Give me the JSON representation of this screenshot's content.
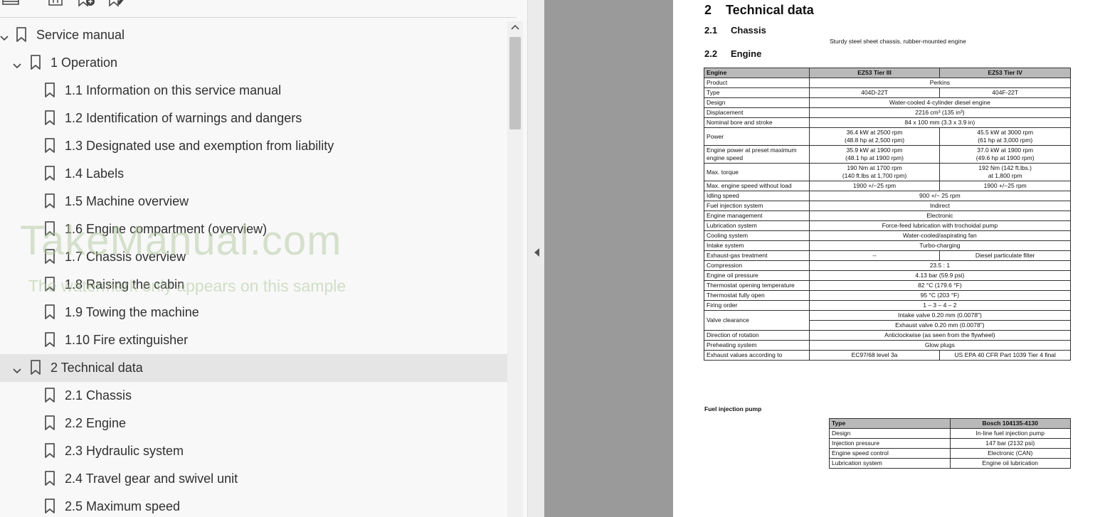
{
  "bookmarks": [
    {
      "label": "Service manual",
      "level": 0,
      "expanded": true,
      "selected": false
    },
    {
      "label": "1 Operation",
      "level": 1,
      "expanded": true,
      "selected": false
    },
    {
      "label": "1.1 Information on this service manual",
      "level": 2
    },
    {
      "label": "1.2 Identification of warnings and dangers",
      "level": 2
    },
    {
      "label": "1.3 Designated use and exemption from liability",
      "level": 2
    },
    {
      "label": "1.4 Labels",
      "level": 2
    },
    {
      "label": "1.5 Machine overview",
      "level": 2
    },
    {
      "label": "1.6 Engine compartment (overview)",
      "level": 2
    },
    {
      "label": "1.7 Chassis overview",
      "level": 2
    },
    {
      "label": "1.8 Raising the cabin",
      "level": 2
    },
    {
      "label": "1.9 Towing the machine",
      "level": 2
    },
    {
      "label": "1.10 Fire extinguisher",
      "level": 2
    },
    {
      "label": "2 Technical data",
      "level": 1,
      "expanded": true,
      "selected": true
    },
    {
      "label": "2.1 Chassis",
      "level": 2
    },
    {
      "label": "2.2 Engine",
      "level": 2
    },
    {
      "label": "2.3 Hydraulic system",
      "level": 2
    },
    {
      "label": "2.4 Travel gear and swivel unit",
      "level": 2
    },
    {
      "label": "2.5 Maximum speed",
      "level": 2
    }
  ],
  "watermark": {
    "main": "TakeManual.com",
    "sub": "The watermark only appears on this sample"
  },
  "document": {
    "section": {
      "num": "2",
      "title": "Technical data"
    },
    "chassis": {
      "num": "2.1",
      "title": "Chassis",
      "desc": "Sturdy steel sheet chassis, rubber-mounted engine"
    },
    "engine": {
      "num": "2.2",
      "title": "Engine"
    },
    "engine_table": {
      "headers": [
        "Engine",
        "EZ53 Tier III",
        "EZ53 Tier IV"
      ],
      "rows": [
        {
          "label": "Product",
          "span": "Perkins"
        },
        {
          "label": "Type",
          "a": "404D-22T",
          "b": "404F-22T"
        },
        {
          "label": "Design",
          "span": "Water-cooled 4-cylinder diesel engine"
        },
        {
          "label": "Displacement",
          "span": "2216 cm³ (135 in³)"
        },
        {
          "label": "Nominal bore and stroke",
          "span": "84 x 100 mm (3.3 x 3.9 in)"
        },
        {
          "label": "Power",
          "a": "36.4 kW at 2500 rpm",
          "a2": "(48.8 hp at 2,500 rpm)",
          "b": "45.5 kW at 3000 rpm",
          "b2": "(61 hp at 3,000 rpm)"
        },
        {
          "label": "Engine power at preset maximum",
          "label2": "engine speed",
          "a": "35.9 kW at 1900 rpm",
          "a2": "(48.1 hp at 1900 rpm)",
          "b": "37.0 kW at 1900 rpm",
          "b2": "(49.6 hp at 1900 rpm)"
        },
        {
          "label": "Max. torque",
          "a": "190 Nm at 1700 rpm",
          "a2": "(140 ft.lbs at 1,700 rpm)",
          "b": "192 Nm (142 ft.lbs.)",
          "b2": "at 1,800 rpm"
        },
        {
          "label": "Max. engine speed without load",
          "a": "1900 +/−25 rpm",
          "b": "1900 +/−25 rpm"
        },
        {
          "label": "Idling speed",
          "span": "900 +/− 25 rpm"
        },
        {
          "label": "Fuel injection system",
          "span": "Indirect"
        },
        {
          "label": "Engine management",
          "span": "Electronic"
        },
        {
          "label": "Lubrication system",
          "span": "Force-feed lubrication with trochoidal pump"
        },
        {
          "label": "Cooling system",
          "span": "Water-cooled/aspirating fan"
        },
        {
          "label": "Intake system",
          "span": "Turbo-charging"
        },
        {
          "label": "Exhaust-gas treatment",
          "a": "--",
          "b": "Diesel particulate filter"
        },
        {
          "label": "Compression",
          "span": "23.5 : 1"
        },
        {
          "label": "Engine oil pressure",
          "span": "4.13 bar (59.9 psi)"
        },
        {
          "label": "Thermostat opening temperature",
          "span": "82 °C (179.6 °F)"
        },
        {
          "label": "Thermostat fully open",
          "span": "95 °C (203 °F)"
        },
        {
          "label": "Firing order",
          "span": "1 – 3 – 4 – 2"
        },
        {
          "label": "Valve clearance",
          "span": "Intake valve 0.20 mm (0.0078\")",
          "span2": "Exhaust valve 0.20 mm (0.0078\")"
        },
        {
          "label": "Direction of rotation",
          "span": "Anticlockwise (as seen from the flywheel)"
        },
        {
          "label": "Preheating system",
          "span": "Glow plugs"
        },
        {
          "label": "Exhaust values according to",
          "a": "EC97/68 level 3a",
          "b": "US EPA 40 CFR Part 1039 Tier 4 final"
        }
      ]
    },
    "fip": {
      "title": "Fuel injection pump",
      "headers": [
        "Type",
        "Bosch 104135-4130"
      ],
      "rows": [
        [
          "Design",
          "In-line fuel injection pump"
        ],
        [
          "Injection pressure",
          "147 bar (2132 psi)"
        ],
        [
          "Engine speed control",
          "Electronic (CAN)"
        ],
        [
          "Lubrication system",
          "Engine oil lubrication"
        ]
      ]
    }
  }
}
